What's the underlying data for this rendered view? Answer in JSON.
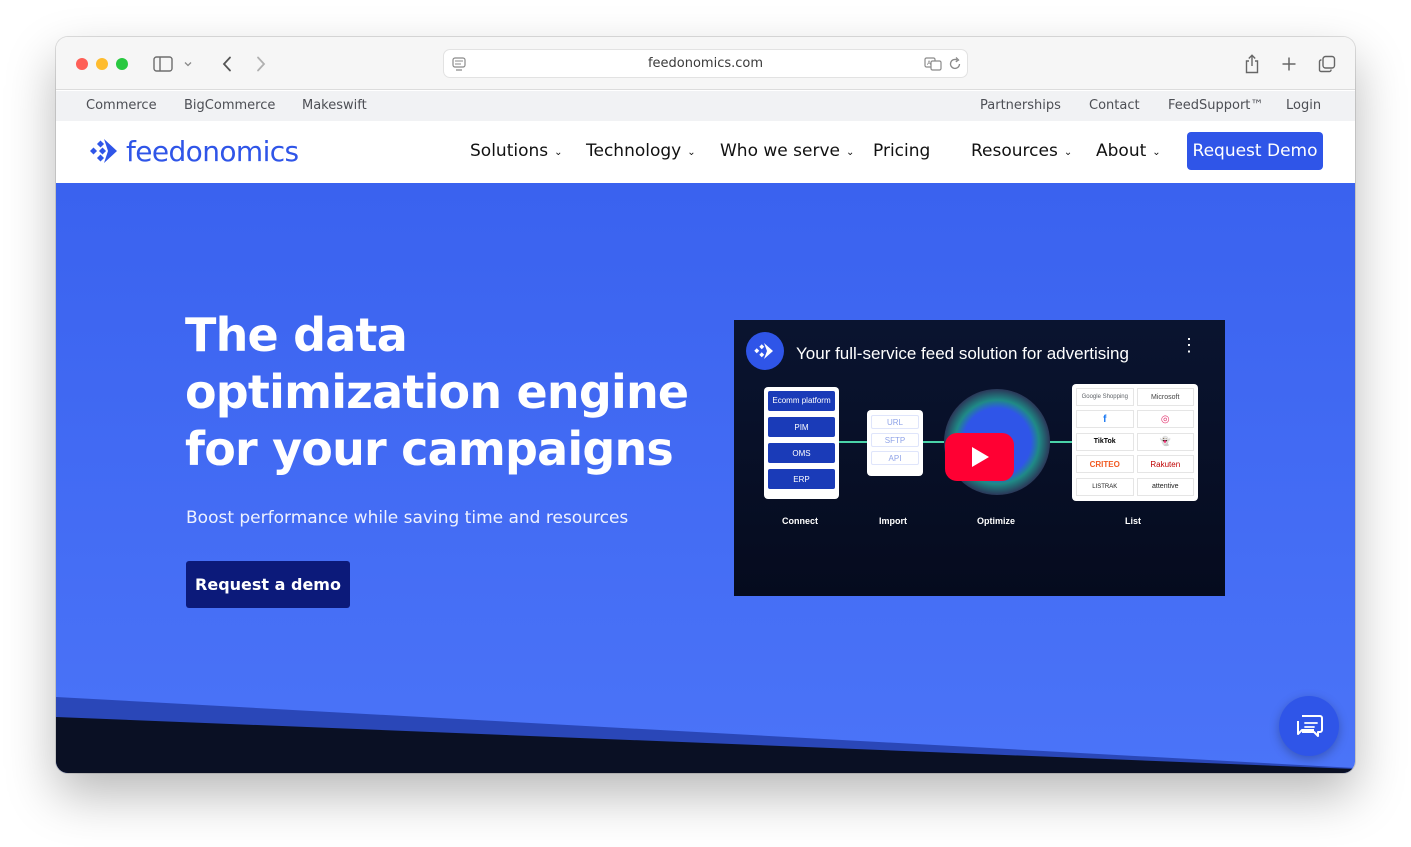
{
  "browser": {
    "url": "feedonomics.com"
  },
  "utility_bar": {
    "left": [
      "Commerce",
      "BigCommerce",
      "Makeswift"
    ],
    "right": [
      "Partnerships",
      "Contact",
      "FeedSupport™",
      "Login"
    ]
  },
  "nav": {
    "logo": "feedonomics",
    "items": [
      "Solutions",
      "Technology",
      "Who we serve",
      "Pricing",
      "Resources",
      "About"
    ],
    "cta": "Request Demo"
  },
  "hero": {
    "title": "The data optimization engine for your campaigns",
    "subtitle": "Boost performance while saving time and resources",
    "cta": "Request a demo"
  },
  "video": {
    "title": "Your full-service feed solution for advertising",
    "connect_items": [
      "Ecomm platform",
      "PIM",
      "OMS",
      "ERP"
    ],
    "import_items": [
      "URL",
      "SFTP",
      "API"
    ],
    "list_items": [
      "Google Shopping",
      "Microsoft",
      "f",
      "◎",
      "TikTok",
      "👻",
      "CRITEO",
      "Rakuten",
      "LISTRAK",
      "attentive"
    ],
    "stages": [
      "Connect",
      "Import",
      "Optimize",
      "List"
    ]
  },
  "colors": {
    "brand": "#2f55e8",
    "hero_bg": "#3a62ef",
    "cta_dark": "#0c1a7a",
    "play": "#ff0033"
  }
}
